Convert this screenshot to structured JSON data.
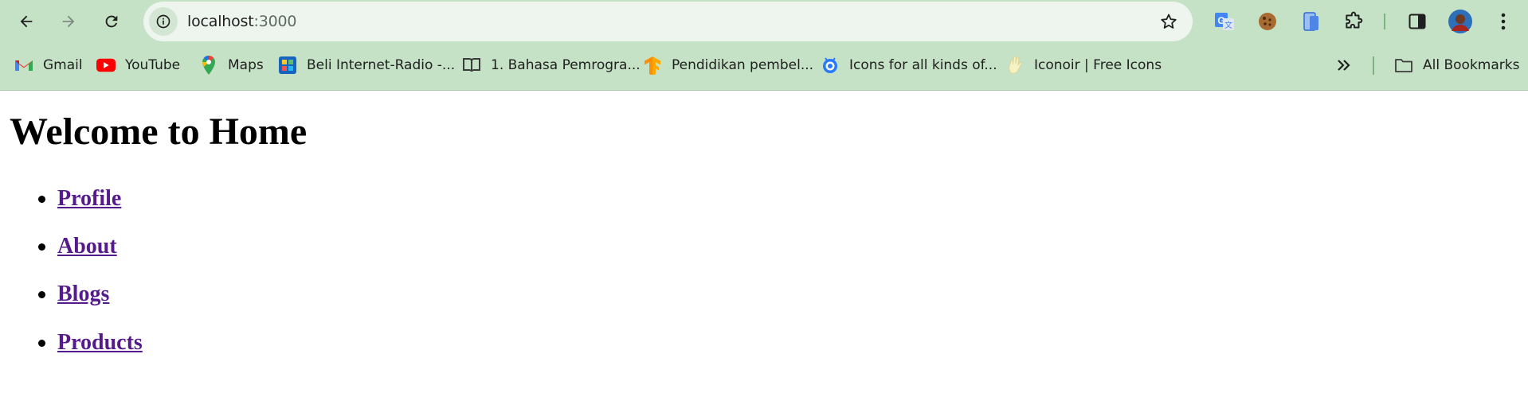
{
  "browser": {
    "url_host": "localhost",
    "url_port": ":3000",
    "bookmarks": [
      {
        "label": "Gmail",
        "icon": "gmail-icon"
      },
      {
        "label": "YouTube",
        "icon": "youtube-icon"
      },
      {
        "label": "Maps",
        "icon": "maps-icon"
      },
      {
        "label": "Beli Internet-Radio -...",
        "icon": "radio-icon"
      },
      {
        "label": "1. Bahasa Pemrogra...",
        "icon": "book-icon"
      },
      {
        "label": "Pendidikan pembel...",
        "icon": "tensorflow-icon"
      },
      {
        "label": "Icons for all kinds of...",
        "icon": "icons-icon"
      },
      {
        "label": "Iconoir | Free Icons",
        "icon": "iconoir-icon"
      }
    ],
    "all_bookmarks_label": "All Bookmarks"
  },
  "page": {
    "heading": "Welcome to Home",
    "links": [
      "Profile",
      "About",
      "Blogs",
      "Products"
    ]
  },
  "colors": {
    "chrome_bg": "#c5e2c6",
    "omnibox_bg": "#edf5ee",
    "link_visited": "#551a8b"
  }
}
